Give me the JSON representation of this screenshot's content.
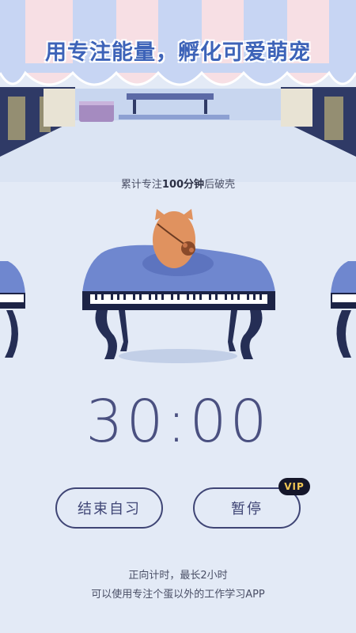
{
  "banner": {
    "title": "用专注能量，孵化可爱萌宠"
  },
  "progress_hint": {
    "prefix": "累计专注",
    "highlight": "100分钟",
    "suffix": "后破壳"
  },
  "timer": {
    "value": "30:00"
  },
  "buttons": {
    "end_label": "结束自习",
    "pause_label": "暂停",
    "vip_badge": "VIP"
  },
  "footer": {
    "line1": "正向计时，最长2小时",
    "line2": "可以使用专注个蛋以外的工作学习APP"
  },
  "colors": {
    "background": "#e3eaf6",
    "title_blue": "#3d63b8",
    "button_border": "#3f4575",
    "vip_bg": "#15162a",
    "vip_text": "#f1c654"
  }
}
